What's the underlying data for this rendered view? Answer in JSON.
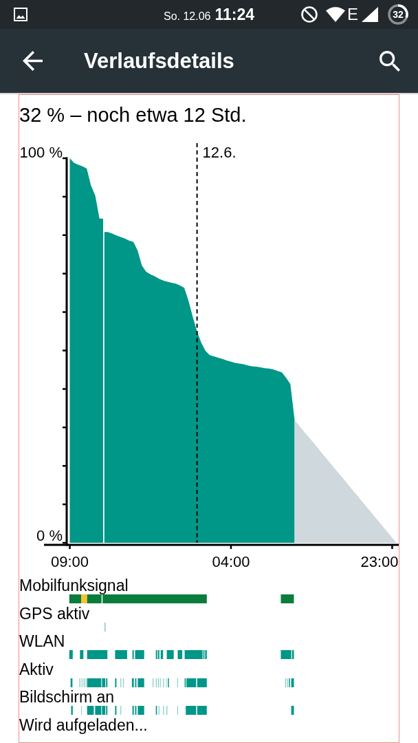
{
  "status_bar": {
    "date": "So. 12.06",
    "time": "11:24",
    "network_type": "E",
    "battery": {
      "label": "32"
    }
  },
  "app_bar": {
    "title": "Verlaufsdetails"
  },
  "summary": "32 % – noch etwa 12 Std.",
  "history_chart": {
    "chart_data": {
      "type": "area",
      "categories": [
        "09:00",
        null,
        null,
        null,
        null,
        null,
        null,
        null,
        null,
        null,
        null,
        null,
        null,
        null,
        null,
        null,
        null,
        null,
        null,
        null,
        null,
        null,
        null,
        null,
        null,
        null,
        null,
        null,
        null,
        null,
        null,
        null,
        null,
        null,
        null,
        null,
        null,
        null,
        "04:00",
        null,
        null,
        null,
        null,
        null,
        null,
        null,
        null,
        null,
        null,
        null,
        null,
        null,
        null,
        null,
        null,
        null,
        null,
        null,
        null,
        null,
        null,
        null,
        null,
        null,
        null,
        null,
        null,
        null,
        null,
        null,
        null,
        null,
        null,
        null,
        null,
        null,
        "23:00",
        null
      ],
      "series": [
        {
          "color": "#009688",
          "values": [
            100,
            98.8,
            98.3,
            97.9,
            97.3,
            92.9,
            90.3,
            84.3,
            null,
            80.8,
            80.4,
            79.9,
            79.5,
            79.1,
            78.6,
            78.2,
            76.0,
            72.1,
            70.5,
            69.8,
            69.3,
            68.7,
            68.2,
            67.9,
            67.6,
            67.4,
            66.9,
            66.3,
            62.9,
            58.7,
            54.9,
            52.0,
            49.9,
            48.8,
            48.5,
            48.1,
            47.8,
            47.4,
            47.1,
            46.8,
            46.6,
            46.4,
            46.1,
            45.9,
            45.8,
            45.6,
            45.4,
            45.3,
            45.1,
            44.7,
            44.3,
            42.9,
            41.3,
            31.9,
            null,
            null,
            null,
            null,
            null,
            null,
            null,
            null,
            null,
            null,
            null,
            null,
            null,
            null,
            null,
            null,
            null,
            null,
            null,
            null,
            null,
            null,
            null,
            null
          ]
        },
        {
          "color": "#cfd8dc",
          "values": [
            null,
            null,
            null,
            null,
            null,
            null,
            null,
            null,
            null,
            null,
            null,
            null,
            null,
            null,
            null,
            null,
            null,
            null,
            null,
            null,
            null,
            null,
            null,
            null,
            null,
            null,
            null,
            null,
            null,
            null,
            null,
            null,
            null,
            null,
            null,
            null,
            null,
            null,
            null,
            null,
            null,
            null,
            null,
            null,
            null,
            null,
            null,
            null,
            null,
            null,
            null,
            null,
            null,
            31.9,
            30.6,
            29.2,
            27.9,
            26.6,
            25.3,
            23.9,
            22.6,
            21.3,
            19.9,
            18.6,
            17.3,
            16.0,
            14.6,
            13.3,
            12.0,
            10.6,
            9.3,
            8.0,
            6.6,
            5.3,
            4.0,
            2.7,
            1.3,
            0
          ]
        }
      ],
      "ylim": [
        0,
        100
      ],
      "yticks": [
        {
          "value": 0,
          "label": "0 %"
        },
        {
          "value": 100,
          "label": "100 %"
        }
      ],
      "annotations": [
        "12.6."
      ]
    }
  },
  "timelines": [
    {
      "label": "Mobilfunksignal"
    },
    {
      "label": "GPS aktiv"
    },
    {
      "label": "WLAN"
    },
    {
      "label": "Aktiv"
    },
    {
      "label": "Bildschirm an"
    },
    {
      "label": "Wird aufgeladen..."
    }
  ]
}
